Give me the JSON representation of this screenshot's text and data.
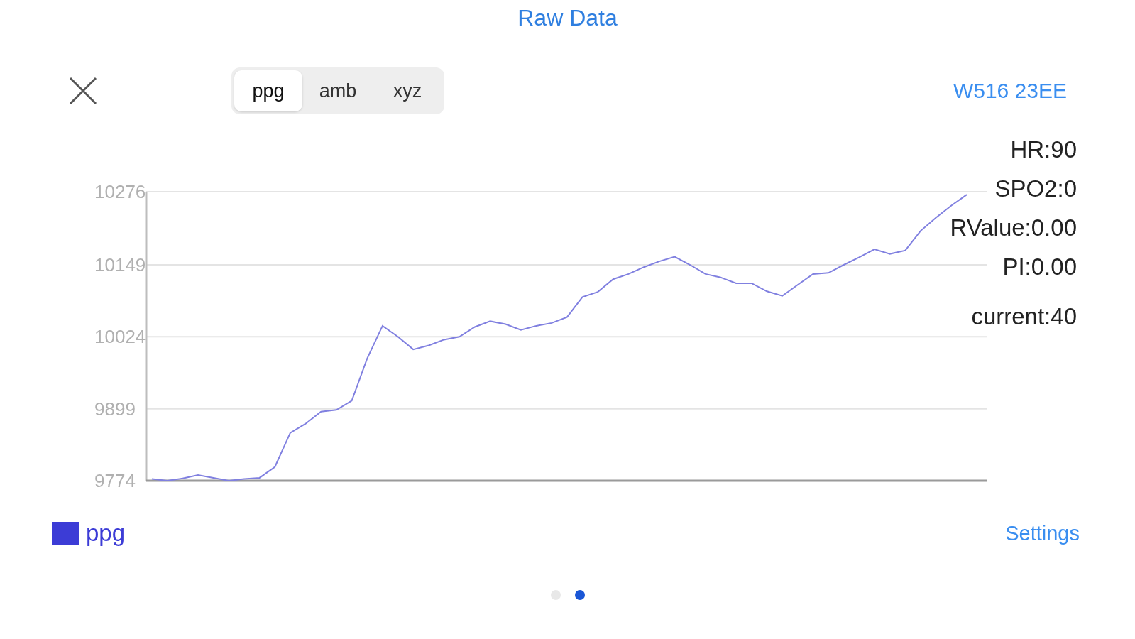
{
  "title": "Raw Data",
  "tabs": [
    {
      "label": "ppg",
      "selected": true
    },
    {
      "label": "amb",
      "selected": false
    },
    {
      "label": "xyz",
      "selected": false
    }
  ],
  "device": "W516 23EE",
  "readings": [
    "HR:90",
    "SPO2:0",
    "RValue:0.00",
    "PI:0.00",
    "current:40"
  ],
  "chart": {
    "chart_data": {
      "type": "line",
      "grid": true,
      "ylim": [
        9774,
        10276
      ],
      "yticks": [
        9774,
        9899,
        10024,
        10149,
        10276
      ],
      "categories": [
        null,
        null,
        null,
        null,
        null,
        null,
        null,
        null,
        null,
        null,
        null,
        null,
        null,
        null,
        null,
        null,
        null,
        null,
        null,
        null,
        null,
        null,
        null,
        null,
        null,
        null,
        null,
        null,
        null,
        null,
        null,
        null,
        null,
        null,
        null,
        null,
        null,
        null,
        null,
        null,
        null,
        null,
        null,
        null,
        null,
        null,
        null,
        null,
        null,
        null,
        null,
        null,
        null,
        null
      ],
      "series": [
        {
          "name": "ppg",
          "color": "#8080e0",
          "values": [
            9777,
            9774,
            9778,
            9784,
            9779,
            9774,
            9777,
            9779,
            9798,
            9857,
            9873,
            9894,
            9897,
            9913,
            9986,
            10043,
            10024,
            10002,
            10009,
            10019,
            10024,
            10041,
            10051,
            10046,
            10036,
            10043,
            10048,
            10058,
            10093,
            10102,
            10124,
            10133,
            10145,
            10155,
            10163,
            10149,
            10133,
            10127,
            10117,
            10117,
            10103,
            10095,
            10114,
            10133,
            10135,
            10149,
            10162,
            10176,
            10168,
            10174,
            10208,
            10231,
            10252,
            10271
          ]
        }
      ]
    }
  },
  "legend": {
    "color": "#3c3cd6"
  },
  "settings": "Settings",
  "page_dots": [
    {
      "selected": false
    },
    {
      "selected": true
    }
  ]
}
